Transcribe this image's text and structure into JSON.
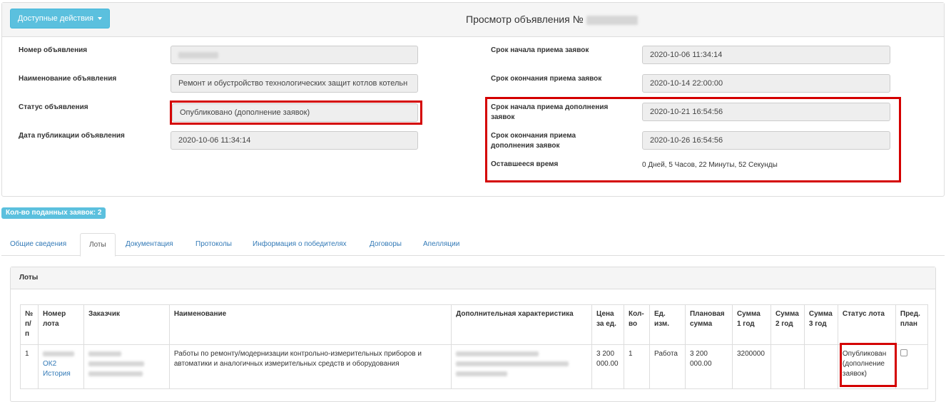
{
  "header": {
    "actions_label": "Доступные действия",
    "title": "Просмотр объявления №"
  },
  "left_fields": {
    "number_label": "Номер объявления",
    "name_label": "Наименование объявления",
    "name_value": "Ремонт и обустройство технологических защит котлов котельн",
    "status_label": "Статус объявления",
    "status_value": "Опубликовано (дополнение заявок)",
    "pub_date_label": "Дата публикации объявления",
    "pub_date_value": "2020-10-06 11:34:14"
  },
  "right_fields": {
    "start_label": "Срок начала приема заявок",
    "start_value": "2020-10-06 11:34:14",
    "end_label": "Срок окончания приема заявок",
    "end_value": "2020-10-14 22:00:00",
    "supp_start_label_1": "Срок начала приема дополнения",
    "supp_start_label_2": "заявок",
    "supp_start_value": "2020-10-21 16:54:56",
    "supp_end_label_1": "Срок окончания приема",
    "supp_end_label_2": "дополнения заявок",
    "supp_end_value": "2020-10-26 16:54:56",
    "remaining_label": "Оставшееся время",
    "remaining_value": "0 Дней, 5 Часов, 22 Минуты, 52 Секунды"
  },
  "badge": "Кол-во поданных заявок: 2",
  "tabs": [
    {
      "label": "Общие сведения"
    },
    {
      "label": "Лоты"
    },
    {
      "label": "Документация"
    },
    {
      "label": "Протоколы"
    },
    {
      "label": "Информация о победителях"
    },
    {
      "label": "Договоры"
    },
    {
      "label": "Апелляции"
    }
  ],
  "lots": {
    "title": "Лоты",
    "headers": {
      "num": [
        "№",
        "п/",
        "п"
      ],
      "lot": [
        "Номер",
        "лота"
      ],
      "customer": "Заказчик",
      "name": "Наименование",
      "extra": "Дополнительная характеристика",
      "price": [
        "Цена",
        "за ед."
      ],
      "qty": [
        "Кол-",
        "во"
      ],
      "unit": [
        "Ед.",
        "изм."
      ],
      "plan": [
        "Плановая",
        "сумма"
      ],
      "y1": [
        "Сумма",
        "1 год"
      ],
      "y2": [
        "Сумма",
        "2 год"
      ],
      "y3": [
        "Сумма",
        "3 год"
      ],
      "status": "Статус лота",
      "preplan": [
        "Пред.",
        "план"
      ]
    },
    "row": {
      "num": "1",
      "lot_code": "ОК2",
      "lot_history": "История",
      "name_1": "Работы по ремонту/модернизации контрольно-измерительных приборов и",
      "name_2": "автоматики и аналогичных измерительных средств и оборудования",
      "price_1": "3 200",
      "price_2": "000.00",
      "qty": "1",
      "unit": "Работа",
      "plan_1": "3 200",
      "plan_2": "000.00",
      "y1": "3200000",
      "status_1": "Опубликован",
      "status_2": "(дополнение",
      "status_3": "заявок)"
    }
  },
  "colors": {
    "info": "#5bc0de",
    "highlight_border": "#d40000",
    "link": "#337ab7"
  }
}
